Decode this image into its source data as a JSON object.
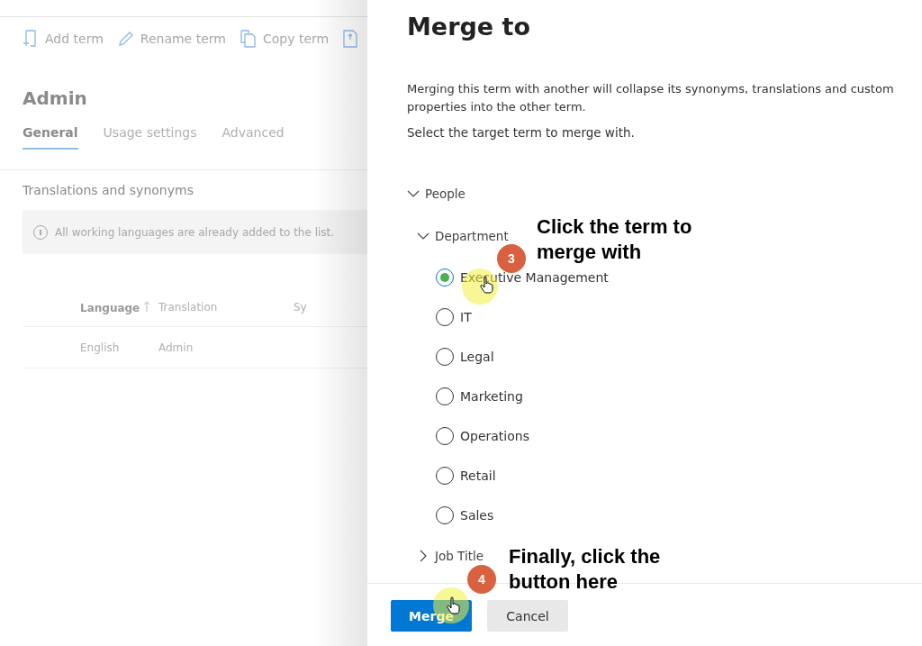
{
  "background_page": {
    "toolbar": [
      {
        "label": "Add term",
        "kind": "add"
      },
      {
        "label": "Rename term",
        "kind": "rename"
      },
      {
        "label": "Copy term",
        "kind": "copy"
      },
      {
        "kind": "move"
      }
    ],
    "title": "Admin",
    "tabs": [
      {
        "label": "General",
        "selected": true
      },
      {
        "label": "Usage settings",
        "selected": false
      },
      {
        "label": "Advanced",
        "selected": false
      }
    ],
    "section_title": "Translations and synonyms",
    "info_message": "All working languages are already added to the list.",
    "table": {
      "columns": [
        "Language",
        "Translation",
        "Sy"
      ],
      "rows": [
        [
          "English",
          "Admin"
        ]
      ]
    }
  },
  "panel": {
    "title": "Merge to",
    "description": "Merging this term with another will collapse its synonyms, translations and custom properties into the other term.",
    "instruction": "Select the target term to merge with.",
    "tree": [
      {
        "label": "People",
        "expanded": true,
        "children": [
          {
            "label": "Department",
            "expanded": true,
            "children": [
              {
                "label": "Executive Management",
                "selected": true
              },
              {
                "label": "IT",
                "selected": false
              },
              {
                "label": "Legal",
                "selected": false
              },
              {
                "label": "Marketing",
                "selected": false
              },
              {
                "label": "Operations",
                "selected": false
              },
              {
                "label": "Retail",
                "selected": false
              },
              {
                "label": "Sales",
                "selected": false
              }
            ]
          },
          {
            "label": "Job Title",
            "expanded": false
          }
        ]
      }
    ],
    "buttons": [
      {
        "label": "Merge",
        "kind": "primary"
      },
      {
        "label": "Cancel",
        "kind": "secondary"
      }
    ]
  },
  "annotations": [
    {
      "number": "3",
      "text": "Click the term to\nmerge with"
    },
    {
      "number": "4",
      "text": "Finally, click the\nbutton here"
    }
  ]
}
